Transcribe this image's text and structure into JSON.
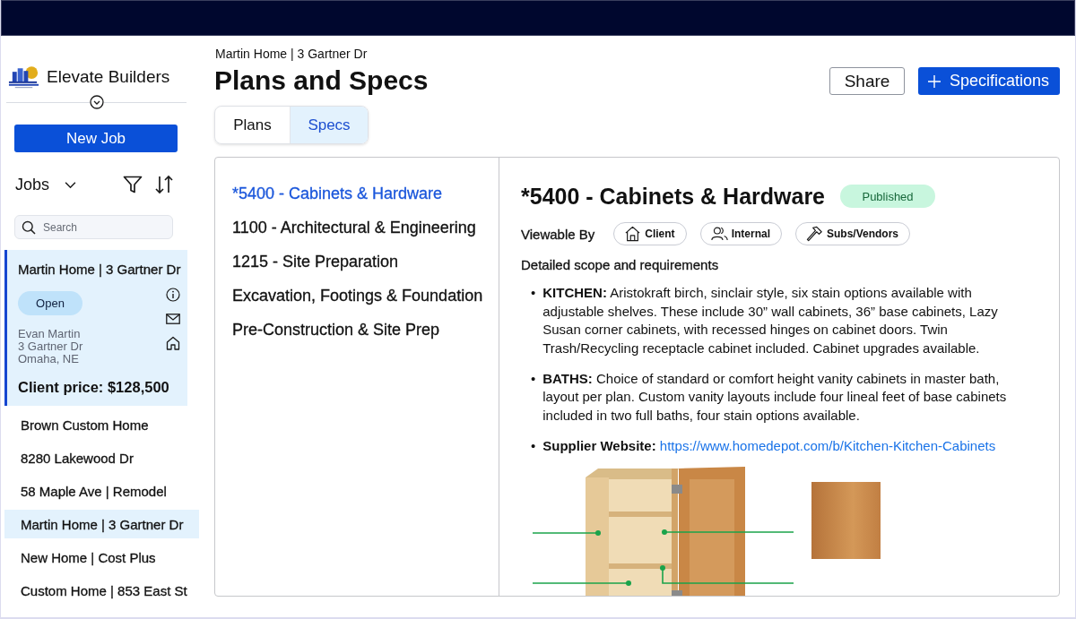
{
  "sidebar": {
    "company_name": "Elevate Builders",
    "new_job_button": "New Job",
    "jobs_heading": "Jobs",
    "search": {
      "placeholder": "Search"
    },
    "job_card": {
      "title": "Martin Home | 3 Gartner Dr",
      "status": "Open",
      "contact_lines": [
        "Evan Martin",
        "3 Gartner Dr",
        "Omaha, NE"
      ],
      "client_price": "Client price: $128,500"
    },
    "jobs": [
      {
        "label": "Brown Custom Home",
        "selected": false
      },
      {
        "label": "8280 Lakewood Dr",
        "selected": false
      },
      {
        "label": "58 Maple Ave | Remodel",
        "selected": false
      },
      {
        "label": "Martin Home | 3 Gartner Dr",
        "selected": true
      },
      {
        "label": "New Home | Cost Plus",
        "selected": false
      },
      {
        "label": "Custom Home | 853 East St",
        "selected": false
      }
    ]
  },
  "header": {
    "breadcrumb": "Martin Home | 3 Gartner Dr",
    "title": "Plans and Specs",
    "buttons": [
      {
        "label": "Share",
        "kind": "outline"
      },
      {
        "label": "Specifications",
        "kind": "add"
      }
    ]
  },
  "tabs": [
    {
      "label": "Plans",
      "selected": false
    },
    {
      "label": "Specs",
      "selected": true
    }
  ],
  "spec_list": [
    {
      "label": "*5400 - Cabinets & Hardware",
      "selected": true
    },
    {
      "label": "1100 - Architectural & Engineering",
      "selected": false
    },
    {
      "label": "1215 - Site Preparation",
      "selected": false
    },
    {
      "label": "Excavation, Footings & Foundation",
      "selected": false
    },
    {
      "label": "Pre-Construction & Site Prep",
      "selected": false
    }
  ],
  "spec_detail": {
    "title": "*5400 - Cabinets & Hardware",
    "status": "Published",
    "viewable_by_label": "Viewable By",
    "audiences": [
      {
        "label": "Client",
        "kind": "client"
      },
      {
        "label": "Internal",
        "kind": "internal"
      },
      {
        "label": "Subs/Vendors",
        "kind": "vendors"
      }
    ],
    "scope_heading": "Detailed scope and requirements",
    "items": [
      {
        "kind": "text",
        "marker": "•",
        "text": "**KITCHEN:** Aristokraft birch, sinclair style, six stain options available with adjustable shelves. These include 30” wall cabinets, 36” base cabinets, Lazy Susan corner cabinets, with recessed hinges on cabinet doors. Twin Trash/Recycling receptacle cabinet included. Cabinet upgrades available."
      },
      {
        "kind": "text",
        "marker": "•",
        "text": "**BATHS:** Choice of standard or comfort height vanity cabinets in master bath, layout per plan. Custom vanity layouts include four lineal feet of base cabinets included in two full baths, four stain options available."
      },
      {
        "kind": "link",
        "marker": "•",
        "text": "**Supplier Website:**",
        "link": "https://www.homedepot.com/b/Kitchen-Kitchen-Cabinets"
      }
    ]
  }
}
